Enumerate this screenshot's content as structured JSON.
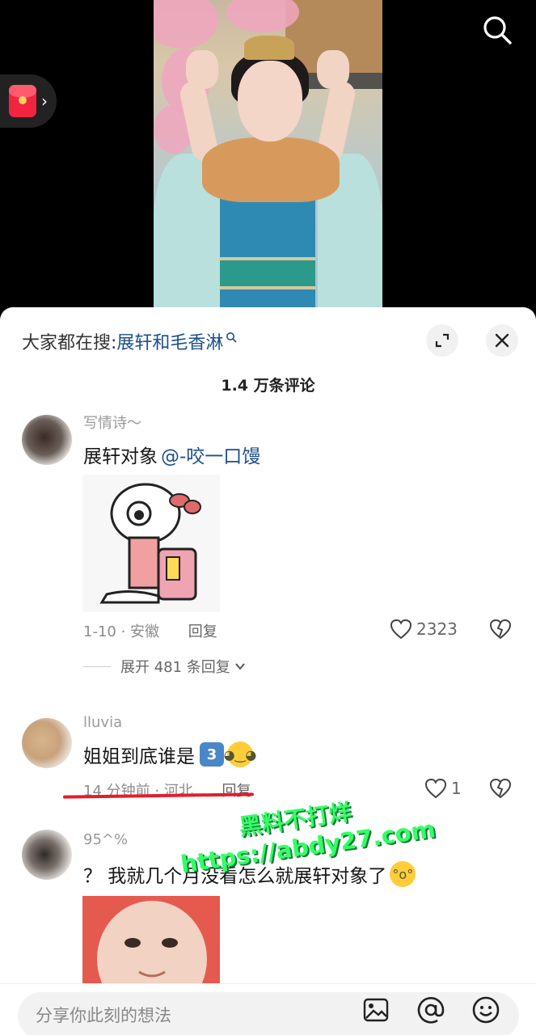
{
  "hot_search": {
    "prefix": "大家都在搜:",
    "keyword": "展轩和毛香淋",
    "suffix_icon": "search-mini-icon"
  },
  "comments_header": {
    "count_label": "1.4 万条评论"
  },
  "comments": [
    {
      "username": "写情诗～",
      "text": "展轩对象",
      "mention": "@-咬一口馒",
      "meta": "1-10 · 安徽",
      "reply_label": "回复",
      "likes": "2323",
      "expand_label": "展开 481 条回复"
    },
    {
      "username": "lluvia",
      "text": "姐姐到底谁是",
      "emoji_digit": "3",
      "meta": "14 分钟前 · 河北",
      "reply_label": "回复",
      "likes": "1"
    },
    {
      "username": "95^%",
      "text": "？ 我就几个月没看怎么就展轩对象了"
    }
  ],
  "watermark": {
    "line1": "黑料不打烊",
    "line2": "https://abdy27.com"
  },
  "input": {
    "placeholder": "分享你此刻的想法"
  },
  "icons": {
    "top_right": "search-icon",
    "left_float": "red-packet-icon",
    "close": "close-icon",
    "expand": "expand-icon",
    "like": "heart-icon",
    "dislike": "broken-heart-icon",
    "bar": [
      "image-icon",
      "at-icon",
      "emoji-icon"
    ]
  }
}
